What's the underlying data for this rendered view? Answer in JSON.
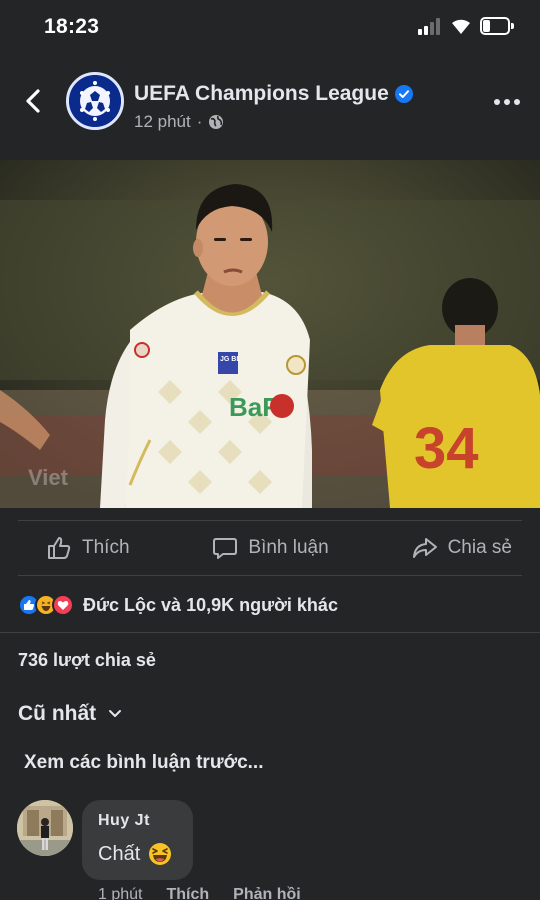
{
  "status_bar": {
    "time": "18:23",
    "battery_level": 0.3,
    "icons": [
      "cellular-signal-icon",
      "wifi-icon",
      "battery-icon"
    ]
  },
  "post": {
    "page_name": "UEFA Champions League",
    "verified": true,
    "timestamp": "12 phút",
    "separator": "·",
    "audience_icon": "globe-icon",
    "photo": {
      "watermark": "Viet",
      "jersey_sponsor": "BaF",
      "jersey_badge": "JG BL",
      "background_player_number": "34"
    }
  },
  "actions": {
    "like": "Thích",
    "comment": "Bình luận",
    "share": "Chia sẻ"
  },
  "reactions": {
    "icons": [
      "like-reaction-icon",
      "haha-reaction-icon",
      "love-reaction-icon"
    ],
    "summary": "Đức Lộc và 10,9K người khác"
  },
  "share_count": "736 lượt chia sẻ",
  "comments": {
    "sort_label": "Cũ nhất",
    "view_previous": "Xem các bình luận trước...",
    "items": [
      {
        "author": "Huy Jt",
        "text": "Chất",
        "emoji": "laughing-emoji-icon",
        "time": "1 phút",
        "like": "Thích",
        "reply": "Phản hồi"
      }
    ]
  },
  "colors": {
    "background": "#242526",
    "text_primary": "#e4e6eb",
    "text_secondary": "#b0b3b8",
    "verified_blue": "#1877f2",
    "bubble": "#3a3b3c",
    "divider": "#3e4042"
  }
}
